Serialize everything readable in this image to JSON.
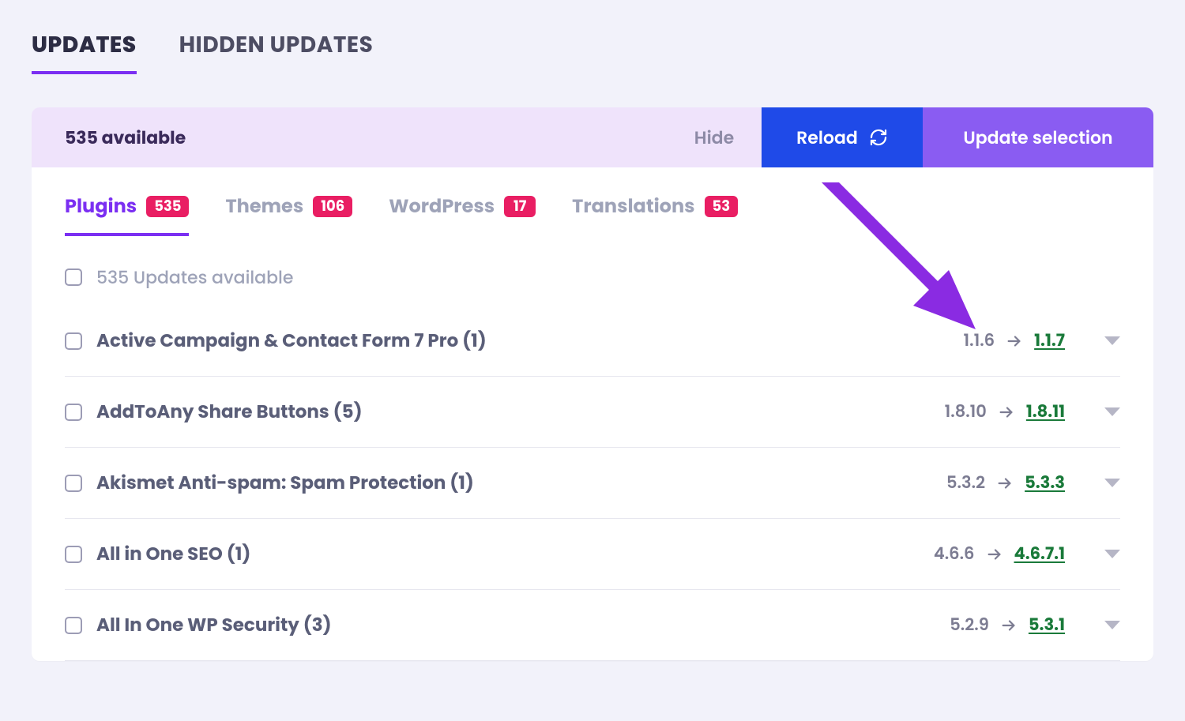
{
  "top_tabs": {
    "updates": "UPDATES",
    "hidden": "HIDDEN UPDATES"
  },
  "band": {
    "available_text": "535 available",
    "hide": "Hide",
    "reload": "Reload",
    "update": "Update selection"
  },
  "category_tabs": {
    "plugins": {
      "label": "Plugins",
      "count": "535"
    },
    "themes": {
      "label": "Themes",
      "count": "106"
    },
    "wordpress": {
      "label": "WordPress",
      "count": "17"
    },
    "translations": {
      "label": "Translations",
      "count": "53"
    }
  },
  "summary": "535 Updates available",
  "rows": [
    {
      "title": "Active Campaign & Contact Form 7 Pro (1)",
      "from": "1.1.6",
      "to": "1.1.7"
    },
    {
      "title": "AddToAny Share Buttons (5)",
      "from": "1.8.10",
      "to": "1.8.11"
    },
    {
      "title": "Akismet Anti-spam: Spam Protection (1)",
      "from": "5.3.2",
      "to": "5.3.3"
    },
    {
      "title": "All in One SEO (1)",
      "from": "4.6.6",
      "to": "4.6.7.1"
    },
    {
      "title": "All In One WP Security (3)",
      "from": "5.2.9",
      "to": "5.3.1"
    }
  ]
}
